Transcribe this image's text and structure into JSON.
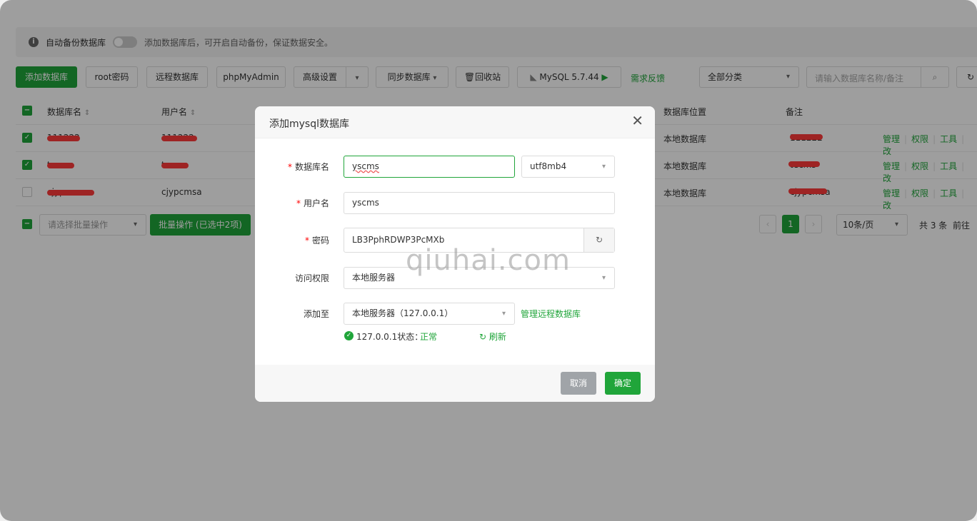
{
  "tip": {
    "label": "自动备份数据库",
    "desc": "添加数据库后，可开启自动备份，保证数据安全。"
  },
  "toolbar": {
    "add_db": "添加数据库",
    "root_pwd": "root密码",
    "remote_db": "远程数据库",
    "phpmyadmin": "phpMyAdmin",
    "advanced": "高级设置",
    "sync": "同步数据库",
    "recycle": "回收站",
    "mysql": "MySQL 5.7.44",
    "feedback": "需求反馈",
    "category": "全部分类",
    "search_placeholder": "请输入数据库名称/备注"
  },
  "table": {
    "headers": {
      "db_name": "数据库名",
      "user": "用户名",
      "location": "数据库位置",
      "note": "备注"
    },
    "rows": [
      {
        "db": "111222",
        "user": "111222",
        "location": "本地数据库",
        "note": "111222",
        "checked": true
      },
      {
        "db": "tecms",
        "user": "tecms",
        "location": "本地数据库",
        "note": "tecms",
        "checked": true
      },
      {
        "db": "cjypcmsa",
        "user": "cjypcmsa",
        "location": "本地数据库",
        "note": "cjypcmsa",
        "checked": false
      }
    ],
    "ops": {
      "manage": "管理",
      "perm": "权限",
      "tools": "工具",
      "edit": "改"
    }
  },
  "footer": {
    "batch_placeholder": "请选择批量操作",
    "batch_btn": "批量操作 (已选中2项)",
    "page": "1",
    "per_page": "10条/页",
    "total": "共 3 条",
    "goto": "前往"
  },
  "modal": {
    "title": "添加mysql数据库",
    "labels": {
      "db_name": "数据库名",
      "user": "用户名",
      "password": "密码",
      "access": "访问权限",
      "add_to": "添加至"
    },
    "db_name": "yscms",
    "charset": "utf8mb4",
    "user": "yscms",
    "password": "LB3PphRDWP3PcMXb",
    "access": "本地服务器",
    "add_to": "本地服务器（127.0.0.1）",
    "manage_remote": "管理远程数据库",
    "status_label": "127.0.0.1状态：",
    "status_value": "正常",
    "refresh": "刷新",
    "cancel": "取消",
    "confirm": "确定"
  },
  "watermark": "qiuhai.com",
  "colors": {
    "accent": "#20a53a",
    "scribble": "#ff3b3b"
  }
}
